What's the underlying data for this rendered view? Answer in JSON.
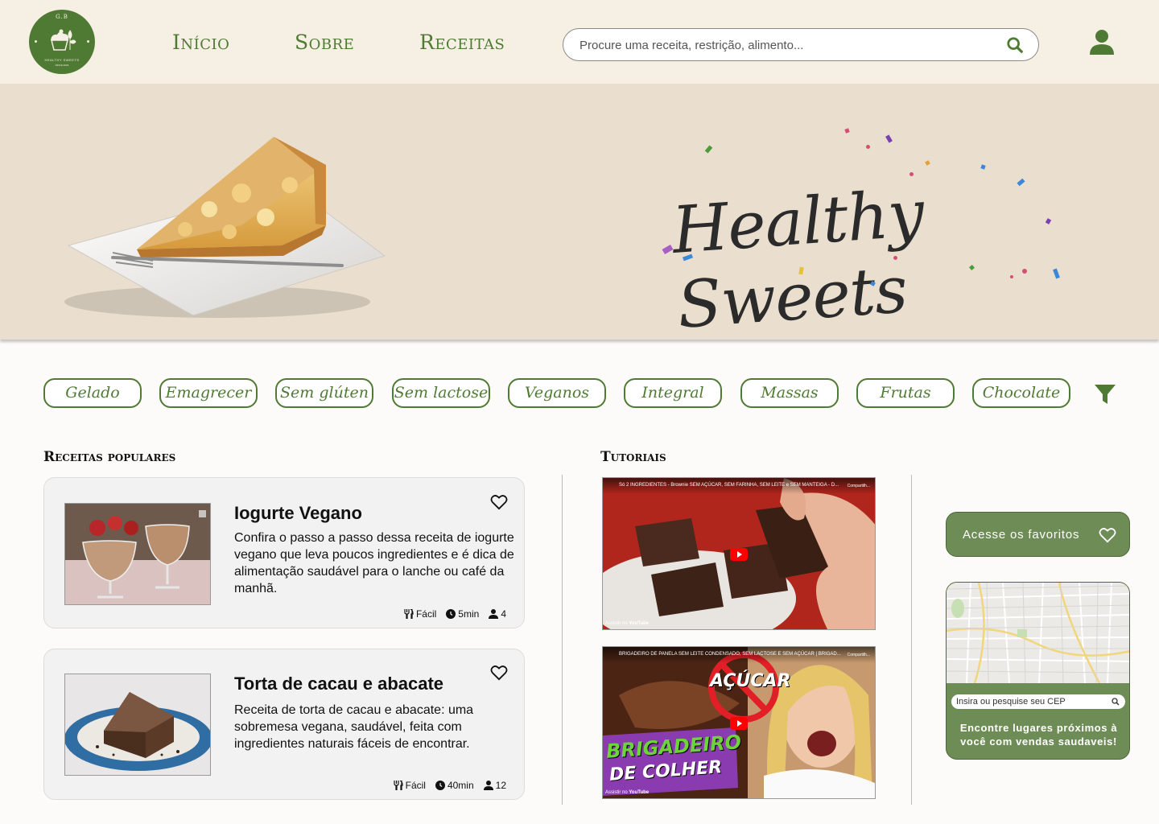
{
  "brand": {
    "logo_top": "G.B",
    "logo_name": "HEALTHY SWEETS",
    "logo_since": "SINCE 2023"
  },
  "nav": {
    "inicio": "Início",
    "sobre": "Sobre",
    "receitas": "Receitas"
  },
  "search": {
    "placeholder": "Procure uma receita, restrição, alimento..."
  },
  "hero": {
    "title": "Healthy Sweets"
  },
  "filters": [
    "Gelado",
    "Emagrecer",
    "Sem glúten",
    "Sem lactose",
    "Veganos",
    "Integral",
    "Massas",
    "Frutas",
    "Chocolate"
  ],
  "sections": {
    "popular": "Receitas populares",
    "tutorials": "Tutoriais"
  },
  "recipes": [
    {
      "title": "Iogurte Vegano",
      "description": "Confira o passo a passo dessa receita de iogurte vegano que leva poucos ingredientes e é dica de alimentação saudável para o lanche ou café da manhã.",
      "difficulty": "Fácil",
      "time": "5min",
      "servings": "4"
    },
    {
      "title": "Torta de cacau e abacate",
      "description": "Receita de torta de cacau e abacate: uma sobremesa vegana, saudável, feita com ingredientes naturais fáceis de encontrar.",
      "difficulty": "Fácil",
      "time": "40min",
      "servings": "12"
    }
  ],
  "videos": [
    {
      "title": "Só 2 INGREDIENTES - Brownie SEM AÇÚCAR, SEM FARINHA, SEM LEITE e SEM MANTEIGA - D...",
      "share": "Compartilh...",
      "watch": "Assistir no",
      "platform": "YouTube"
    },
    {
      "title": "BRIGADEIRO DE PANELA SEM LEITE CONDENSADO, SEM LACTOSE E SEM AÇÚCAR | BRIGAD...",
      "share": "Compartilh...",
      "watch": "Assistir no",
      "platform": "YouTube",
      "overlay_top": "AÇÚCAR",
      "overlay_line1": "BRIGADEIRO",
      "overlay_line2": "DE COLHER"
    }
  ],
  "favorites": {
    "label": "Acesse os favoritos"
  },
  "map": {
    "cep_placeholder": "Insira ou pesquise seu CEP",
    "line1": "Encontre lugares próximos à",
    "line2": "você com vendas saudaveis!"
  },
  "colors": {
    "brand_green": "#4f7a33",
    "button_green": "#6e8c55",
    "header_bg": "#f6efe3",
    "hero_bg": "#eadfce"
  }
}
